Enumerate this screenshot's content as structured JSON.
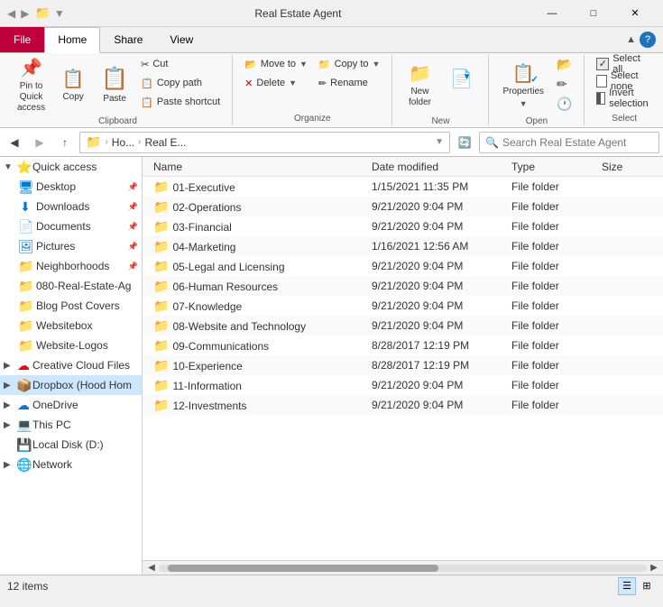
{
  "titleBar": {
    "title": "Real Estate Agent",
    "minimizeLabel": "—",
    "maximizeLabel": "□",
    "closeLabel": "✕"
  },
  "ribbon": {
    "tabs": [
      {
        "id": "file",
        "label": "File"
      },
      {
        "id": "home",
        "label": "Home",
        "active": true
      },
      {
        "id": "share",
        "label": "Share"
      },
      {
        "id": "view",
        "label": "View"
      }
    ],
    "groups": {
      "clipboard": {
        "label": "Clipboard",
        "pinLabel": "Pin to Quick\naccess",
        "copyLabel": "Copy",
        "pasteLabel": "Paste",
        "cutLabel": "Cut",
        "copyPathLabel": "Copy path",
        "pasteShortcutLabel": "Paste shortcut"
      },
      "organize": {
        "label": "Organize",
        "moveToLabel": "Move to",
        "deleteLabel": "Delete",
        "copyToLabel": "Copy to",
        "renameLabel": "Rename"
      },
      "new": {
        "label": "New",
        "newFolderLabel": "New\nfolder"
      },
      "open": {
        "label": "Open",
        "propertiesLabel": "Properties"
      },
      "select": {
        "label": "Select",
        "selectAllLabel": "Select all",
        "selectNoneLabel": "Select none",
        "invertSelectionLabel": "Invert selection"
      }
    }
  },
  "addressBar": {
    "backDisabled": false,
    "forwardDisabled": true,
    "upLabel": "↑",
    "path": [
      "Ho...",
      "Real E..."
    ],
    "searchPlaceholder": "Search Real Estate Agent"
  },
  "sidebar": {
    "sections": [
      {
        "id": "quick-access",
        "label": "Quick access",
        "expanded": true,
        "icon": "⭐",
        "items": [
          {
            "id": "desktop",
            "label": "Desktop",
            "icon": "🖥",
            "pinned": true
          },
          {
            "id": "downloads",
            "label": "Downloads",
            "icon": "⬇",
            "pinned": true
          },
          {
            "id": "documents",
            "label": "Documents",
            "icon": "📄",
            "pinned": true
          },
          {
            "id": "pictures",
            "label": "Pictures",
            "icon": "🖼",
            "pinned": true
          },
          {
            "id": "neighborhoods",
            "label": "Neighborhoods",
            "icon": "📁",
            "pinned": true
          },
          {
            "id": "real-estate-ag",
            "label": "080-Real-Estate-Ag",
            "icon": "📁",
            "pinned": false
          },
          {
            "id": "blog-post-covers",
            "label": "Blog Post Covers",
            "icon": "📁",
            "pinned": false
          },
          {
            "id": "websitebox",
            "label": "Websitebox",
            "icon": "📁",
            "pinned": false
          },
          {
            "id": "website-logos",
            "label": "Website-Logos",
            "icon": "📁",
            "pinned": false
          }
        ]
      },
      {
        "id": "creative-cloud",
        "label": "Creative Cloud Files",
        "icon": "☁",
        "expanded": false
      },
      {
        "id": "dropbox",
        "label": "Dropbox (Hood Hom",
        "icon": "📦",
        "expanded": false,
        "selected": true
      },
      {
        "id": "onedrive",
        "label": "OneDrive",
        "icon": "☁",
        "expanded": false
      },
      {
        "id": "this-pc",
        "label": "This PC",
        "icon": "💻",
        "expanded": false
      },
      {
        "id": "local-disk",
        "label": "Local Disk (D:)",
        "icon": "💾",
        "expanded": false
      },
      {
        "id": "network",
        "label": "Network",
        "icon": "🌐",
        "expanded": false
      }
    ]
  },
  "fileList": {
    "columns": {
      "name": "Name",
      "dateModified": "Date modified",
      "type": "Type",
      "size": "Size"
    },
    "items": [
      {
        "name": "01-Executive",
        "date": "1/15/2021 11:35 PM",
        "type": "File folder",
        "size": ""
      },
      {
        "name": "02-Operations",
        "date": "9/21/2020 9:04 PM",
        "type": "File folder",
        "size": ""
      },
      {
        "name": "03-Financial",
        "date": "9/21/2020 9:04 PM",
        "type": "File folder",
        "size": ""
      },
      {
        "name": "04-Marketing",
        "date": "1/16/2021 12:56 AM",
        "type": "File folder",
        "size": ""
      },
      {
        "name": "05-Legal and Licensing",
        "date": "9/21/2020 9:04 PM",
        "type": "File folder",
        "size": ""
      },
      {
        "name": "06-Human Resources",
        "date": "9/21/2020 9:04 PM",
        "type": "File folder",
        "size": ""
      },
      {
        "name": "07-Knowledge",
        "date": "9/21/2020 9:04 PM",
        "type": "File folder",
        "size": ""
      },
      {
        "name": "08-Website and Technology",
        "date": "9/21/2020 9:04 PM",
        "type": "File folder",
        "size": ""
      },
      {
        "name": "09-Communications",
        "date": "8/28/2017 12:19 PM",
        "type": "File folder",
        "size": ""
      },
      {
        "name": "10-Experience",
        "date": "8/28/2017 12:19 PM",
        "type": "File folder",
        "size": ""
      },
      {
        "name": "11-Information",
        "date": "9/21/2020 9:04 PM",
        "type": "File folder",
        "size": ""
      },
      {
        "name": "12-Investments",
        "date": "9/21/2020 9:04 PM",
        "type": "File folder",
        "size": ""
      }
    ]
  },
  "statusBar": {
    "itemCount": "12 items"
  }
}
